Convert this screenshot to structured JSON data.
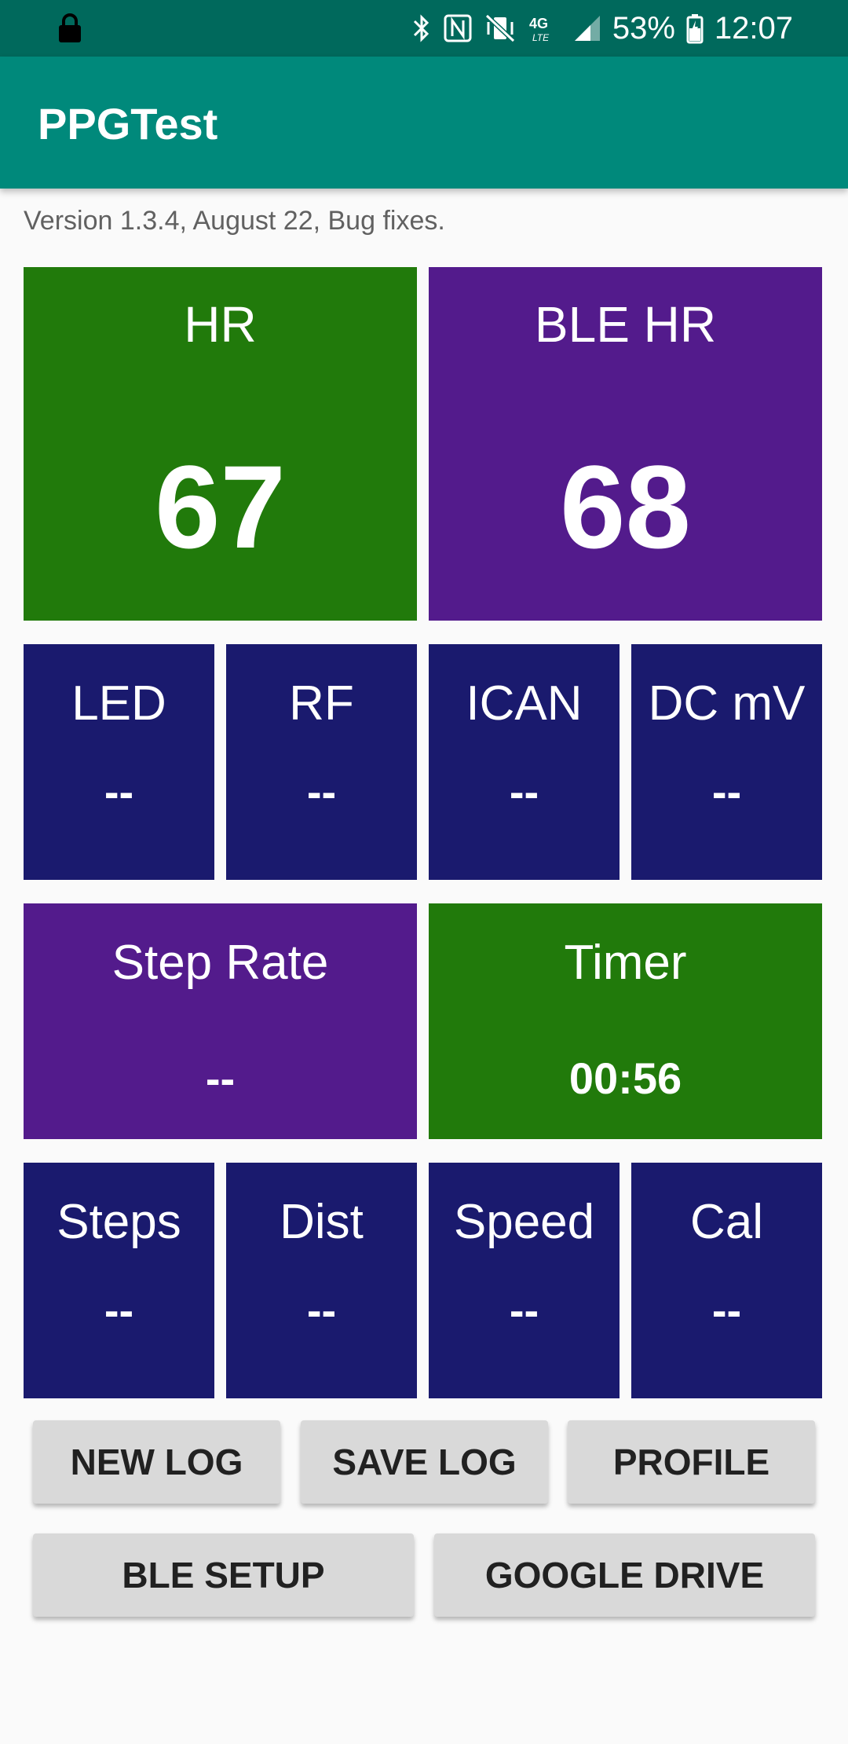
{
  "status_bar": {
    "battery": "53%",
    "time": "12:07",
    "network": "4G LTE",
    "icons": [
      "lock-icon",
      "bluetooth-icon",
      "nfc-icon",
      "vibrate-mute-icon",
      "lte-icon",
      "signal-icon",
      "battery-icon"
    ]
  },
  "app_bar": {
    "title": "PPGTest"
  },
  "version_text": "Version 1.3.4, August 22, Bug fixes.",
  "colors": {
    "green": "#217a0b",
    "purple": "#531b8c",
    "navy": "#1a1a6e",
    "app_bar": "#00897b",
    "status_bar": "#00695c"
  },
  "tiles": {
    "hr": {
      "label": "HR",
      "value": "67"
    },
    "ble_hr": {
      "label": "BLE HR",
      "value": "68"
    },
    "led": {
      "label": "LED",
      "value": "--"
    },
    "rf": {
      "label": "RF",
      "value": "--"
    },
    "ican": {
      "label": "ICAN",
      "value": "--"
    },
    "dc_mv": {
      "label": "DC mV",
      "value": "--"
    },
    "step_rate": {
      "label": "Step Rate",
      "value": "--"
    },
    "timer": {
      "label": "Timer",
      "value": "00:56"
    },
    "steps": {
      "label": "Steps",
      "value": "--"
    },
    "dist": {
      "label": "Dist",
      "value": "--"
    },
    "speed": {
      "label": "Speed",
      "value": "--"
    },
    "cal": {
      "label": "Cal",
      "value": "--"
    }
  },
  "buttons": {
    "new_log": "NEW LOG",
    "save_log": "SAVE LOG",
    "profile": "PROFILE",
    "ble_setup": "BLE SETUP",
    "google_drive": "GOOGLE DRIVE"
  }
}
